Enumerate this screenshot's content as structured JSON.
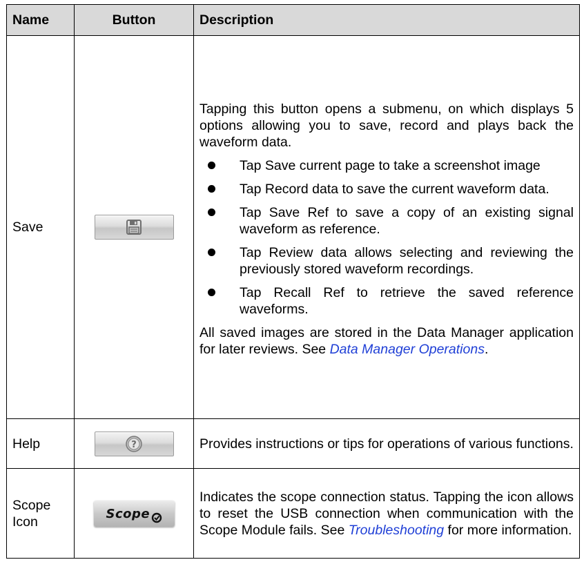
{
  "header": {
    "name": "Name",
    "button": "Button",
    "description": "Description"
  },
  "rows": {
    "save": {
      "name": "Save",
      "icon": "floppy-disk-icon",
      "intro": "Tapping this button opens a submenu, on which displays 5 options allowing you to save, record and plays back the waveform data.",
      "bullets": [
        "Tap Save current page to take a screenshot image",
        "Tap Record data to save the current waveform data.",
        "Tap Save Ref to save a copy of an existing signal waveform as reference.",
        "Tap Review data allows selecting and reviewing the previously stored waveform recordings.",
        "Tap Recall Ref to retrieve the saved reference waveforms."
      ],
      "outro_text": "All saved images are stored in the Data Manager application for later reviews. See ",
      "outro_link": "Data Manager Operations",
      "outro_end": "."
    },
    "help": {
      "name": "Help",
      "icon": "question-mark-icon",
      "description": "Provides instructions or tips for operations of various functions."
    },
    "scope": {
      "name": "Scope Icon",
      "badge_text": "Scope",
      "icon": "scope-connection-icon",
      "description_text": "Indicates the scope connection status. Tapping the icon allows to reset the USB connection when communication with the Scope Module fails. See ",
      "description_link": "Troubleshooting",
      "description_end": " for more information."
    }
  },
  "colors": {
    "header_bg": "#d9d9d9",
    "link": "#1f3fd6",
    "border": "#000000"
  }
}
